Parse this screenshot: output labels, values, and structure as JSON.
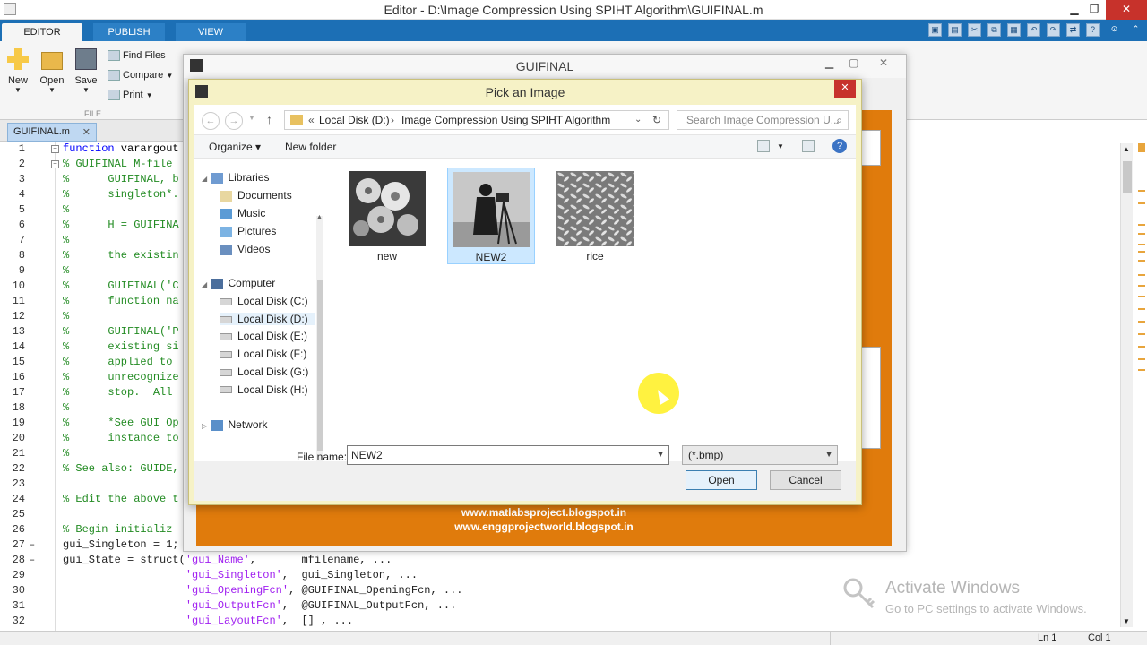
{
  "window": {
    "title": "Editor - D:\\Image Compression Using SPIHT Algorithm\\GUIFINAL.m",
    "min": "▁",
    "max": "❐",
    "close": "✕"
  },
  "ribbon": {
    "tabs": [
      "EDITOR",
      "PUBLISH",
      "VIEW"
    ],
    "buttons": {
      "new": "New",
      "open": "Open",
      "save": "Save"
    },
    "small": {
      "find_files": "Find Files",
      "compare": "Compare",
      "print": "Print"
    },
    "group_label": "FILE"
  },
  "editor": {
    "file_tab": "GUIFINAL.m",
    "lines": [
      {
        "n": "1",
        "m": "",
        "t": "function varargout",
        "k": "kw"
      },
      {
        "n": "2",
        "m": "",
        "t": "% GUIFINAL M-file",
        "k": "cmt"
      },
      {
        "n": "3",
        "m": "",
        "t": "%      GUIFINAL, b",
        "k": "cmt"
      },
      {
        "n": "4",
        "m": "",
        "t": "%      singleton*.",
        "k": "cmt"
      },
      {
        "n": "5",
        "m": "",
        "t": "%",
        "k": "cmt"
      },
      {
        "n": "6",
        "m": "",
        "t": "%      H = GUIFINA",
        "k": "cmt"
      },
      {
        "n": "7",
        "m": "",
        "t": "%",
        "k": "cmt"
      },
      {
        "n": "8",
        "m": "",
        "t": "%      the existin",
        "k": "cmt"
      },
      {
        "n": "9",
        "m": "",
        "t": "%",
        "k": "cmt"
      },
      {
        "n": "10",
        "m": "",
        "t": "%      GUIFINAL('C",
        "k": "cmt"
      },
      {
        "n": "11",
        "m": "",
        "t": "%      function na",
        "k": "cmt"
      },
      {
        "n": "12",
        "m": "",
        "t": "%",
        "k": "cmt"
      },
      {
        "n": "13",
        "m": "",
        "t": "%      GUIFINAL('P",
        "k": "cmt"
      },
      {
        "n": "14",
        "m": "",
        "t": "%      existing si",
        "k": "cmt"
      },
      {
        "n": "15",
        "m": "",
        "t": "%      applied to ",
        "k": "cmt"
      },
      {
        "n": "16",
        "m": "",
        "t": "%      unrecognize",
        "k": "cmt"
      },
      {
        "n": "17",
        "m": "",
        "t": "%      stop.  All ",
        "k": "cmt"
      },
      {
        "n": "18",
        "m": "",
        "t": "%",
        "k": "cmt"
      },
      {
        "n": "19",
        "m": "",
        "t": "%      *See GUI Op",
        "k": "cmt"
      },
      {
        "n": "20",
        "m": "",
        "t": "%      instance to",
        "k": "cmt"
      },
      {
        "n": "21",
        "m": "",
        "t": "%",
        "k": "cmt"
      },
      {
        "n": "22",
        "m": "",
        "t": "% See also: GUIDE,",
        "k": "cmt"
      },
      {
        "n": "23",
        "m": "",
        "t": "",
        "k": ""
      },
      {
        "n": "24",
        "m": "",
        "t": "% Edit the above t",
        "k": "cmt"
      },
      {
        "n": "25",
        "m": "",
        "t": "",
        "k": ""
      },
      {
        "n": "26",
        "m": "",
        "t": "% Begin initializ",
        "k": "cmt"
      },
      {
        "n": "27",
        "m": "–",
        "t": "gui_Singleton = 1;",
        "k": ""
      },
      {
        "n": "28",
        "m": "–",
        "t": "gui_State = struct('gui_Name',       mfilename, ...",
        "k": "mix"
      },
      {
        "n": "29",
        "m": "",
        "t": "                   'gui_Singleton',  gui_Singleton, ...",
        "k": "mix"
      },
      {
        "n": "30",
        "m": "",
        "t": "                   'gui_OpeningFcn', @GUIFINAL_OpeningFcn, ...",
        "k": "mix"
      },
      {
        "n": "31",
        "m": "",
        "t": "                   'gui_OutputFcn',  @GUIFINAL_OutputFcn, ...",
        "k": "mix"
      },
      {
        "n": "32",
        "m": "",
        "t": "                   'gui_LayoutFcn',  [] , ...",
        "k": "mix"
      }
    ]
  },
  "gui": {
    "title": "GUIFINAL",
    "links": [
      "www.matlabsproject.blogspot.in",
      "www.enggprojectworld.blogspot.in"
    ]
  },
  "dialog": {
    "title": "Pick an Image",
    "address": {
      "prefix": "«",
      "drive": "Local Disk (D:)",
      "folder": "Image Compression Using SPIHT Algorithm"
    },
    "search_placeholder": "Search Image Compression U...",
    "organize": "Organize ▾",
    "new_folder": "New folder",
    "nav": {
      "libraries": "Libraries",
      "lib_items": [
        "Documents",
        "Music",
        "Pictures",
        "Videos"
      ],
      "computer": "Computer",
      "drives": [
        "Local Disk (C:)",
        "Local Disk (D:)",
        "Local Disk (E:)",
        "Local Disk (F:)",
        "Local Disk (G:)",
        "Local Disk (H:)"
      ],
      "network": "Network"
    },
    "files": [
      {
        "name": "new",
        "selected": false
      },
      {
        "name": "NEW2",
        "selected": true
      },
      {
        "name": "rice",
        "selected": false
      }
    ],
    "file_name_label": "File name:",
    "file_name_value": "NEW2",
    "file_type": "(*.bmp)",
    "open_button": "Open",
    "cancel_button": "Cancel"
  },
  "status": {
    "ln": "Ln  1",
    "col": "Col  1"
  },
  "watermark": {
    "line1": "Activate Windows",
    "line2": "Go to PC settings to activate Windows."
  }
}
